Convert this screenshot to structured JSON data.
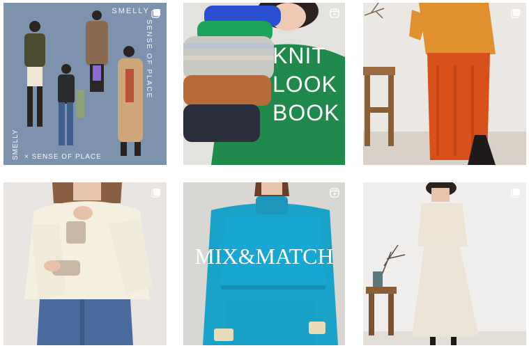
{
  "posts": [
    {
      "texts": {
        "top_brand": "SMELLY",
        "vertical_right": "SENSE OF PLACE",
        "vertical_left": "SMELLY",
        "bottom_line": "× SENSE OF PLACE"
      },
      "badge_icon": "carousel-icon"
    },
    {
      "title_lines": [
        "KNIT",
        "LOOK",
        "BOOK"
      ],
      "badge_icon": "reel-icon"
    },
    {
      "badge_icon": "carousel-icon"
    },
    {
      "badge_icon": "carousel-icon"
    },
    {
      "title": "MIX&MATCH",
      "badge_icon": "reel-icon"
    },
    {
      "badge_icon": "carousel-icon"
    }
  ],
  "colors": {
    "tile1_bg": "#7d93ad",
    "knit_green": "#1f8a4c",
    "orange_skirt": "#d8501a",
    "turquoise": "#1aa3c9"
  }
}
